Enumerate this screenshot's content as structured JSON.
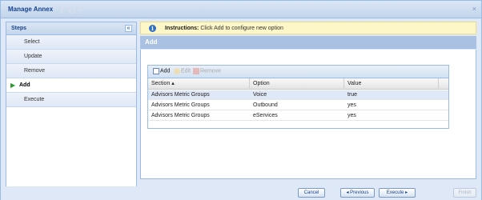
{
  "window": {
    "title": "Manage Annex",
    "title_ghost": "FOF",
    "close_glyph": "×"
  },
  "sidebar": {
    "title": "Steps",
    "collapse_glyph": "«",
    "items": [
      {
        "label": "Select",
        "active": false
      },
      {
        "label": "Update",
        "active": false
      },
      {
        "label": "Remove",
        "active": false
      },
      {
        "label": "Add",
        "active": true
      },
      {
        "label": "Execute",
        "active": false
      }
    ],
    "active_marker": "▶"
  },
  "instructions": {
    "icon": "i",
    "prefix": "Instructions:",
    "text": "Click Add to configure new option"
  },
  "panel": {
    "title": "Add"
  },
  "grid": {
    "toolbar": {
      "add": "Add",
      "edit": "Edit",
      "remove": "Remove"
    },
    "columns": [
      "Section ▴",
      "Option",
      "Value"
    ],
    "rows": [
      [
        "Advisors Metric Groups",
        "Voice",
        "true"
      ],
      [
        "Advisors Metric Groups",
        "Outbound",
        "yes"
      ],
      [
        "Advisors Metric Groups",
        "eServices",
        "yes"
      ]
    ]
  },
  "footer": {
    "cancel": "Cancel",
    "previous": "◂ Previous",
    "execute": "Execute ▸",
    "finish": "Finish"
  },
  "colors": {
    "accent": "#15428b",
    "panel_header": "#a9c2e3",
    "selected_row": "#dfe8f6",
    "instruction_bg": "#fdf7c7"
  }
}
